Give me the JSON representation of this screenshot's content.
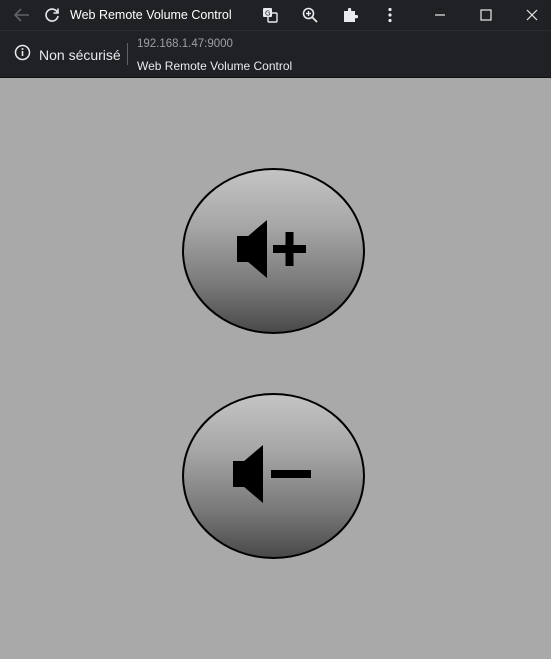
{
  "window": {
    "title": "Web Remote Volume Control"
  },
  "address_bar": {
    "security_label": "Non sécurisé",
    "url": "192.168.1.47:9000",
    "page_title": "Web Remote Volume Control"
  },
  "icons": {
    "back": "back-arrow-icon",
    "reload": "reload-icon",
    "translate": "translate-icon",
    "zoom": "zoom-icon",
    "extensions": "puzzle-icon",
    "menu": "kebab-menu-icon",
    "minimize": "minimize-icon",
    "maximize": "maximize-icon",
    "close": "close-icon",
    "info": "info-icon",
    "volume_up": "volume-up-icon",
    "volume_down": "volume-down-icon"
  },
  "colors": {
    "chrome_dark": "#202124",
    "page_background": "#a9a9a9",
    "button_border": "#000000"
  }
}
